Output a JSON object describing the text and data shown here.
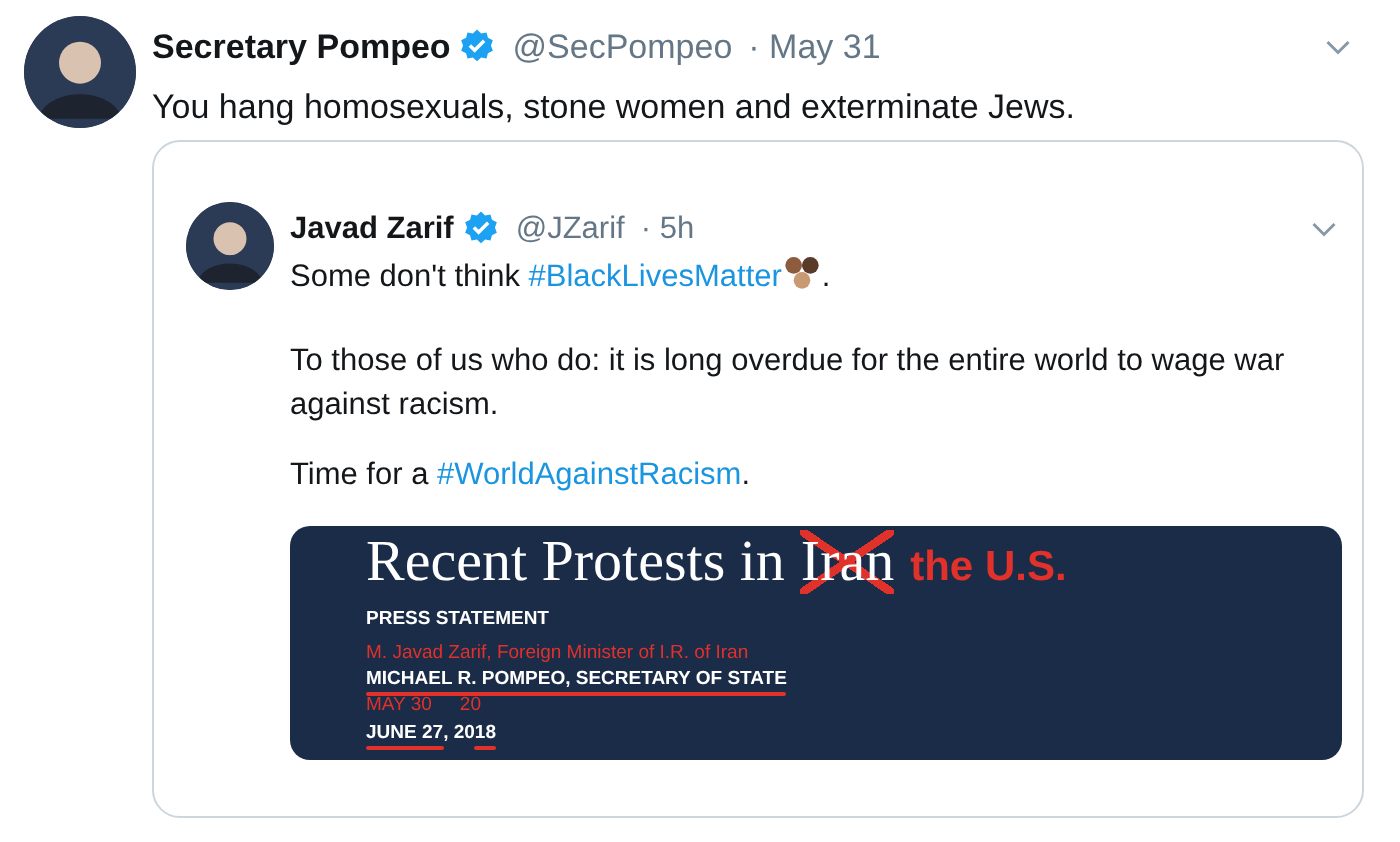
{
  "tweet": {
    "author": {
      "name": "Secretary Pompeo",
      "verified": true,
      "handle": "@SecPompeo",
      "time": "· May 31"
    },
    "text": [
      {
        "kind": "text",
        "text": "You hang homosexuals, stone women and exterminate Jews."
      }
    ],
    "quoted": {
      "author": {
        "name": "Javad Zarif",
        "verified": true,
        "handle": "@JZarif",
        "time": "· 5h"
      },
      "paragraphs": [
        [
          {
            "kind": "text",
            "text": "Some don't think "
          },
          {
            "kind": "hashtag",
            "text": "#BlackLivesMatter"
          },
          {
            "kind": "emoji"
          },
          {
            "kind": "text",
            "text": "."
          }
        ],
        [
          {
            "kind": "text",
            "text": "To those of us who do: it is long overdue for the entire world to wage war against racism."
          }
        ],
        [
          {
            "kind": "text",
            "text": "Time for a "
          },
          {
            "kind": "hashtag",
            "text": "#WorldAgainstRacism"
          },
          {
            "kind": "text",
            "text": "."
          }
        ]
      ],
      "image": {
        "title": [
          {
            "kind": "plain",
            "text": "Recent Protests in"
          },
          {
            "kind": "crossed",
            "text": "Iran"
          },
          {
            "kind": "inserted",
            "text": "the U.S."
          }
        ],
        "lines": [
          [
            {
              "kind": "heading",
              "text": "PRESS STATEMENT"
            }
          ],
          [
            {
              "kind": "inserted",
              "text": "M. Javad Zarif, Foreign Minister of I.R. of Iran"
            }
          ],
          [
            {
              "kind": "struck",
              "text": "MICHAEL R. POMPEO, SECRETARY OF STATE"
            }
          ],
          [
            {
              "kind": "inserted",
              "text": "MAY 30"
            },
            {
              "kind": "inserted",
              "text": "20"
            }
          ],
          [
            {
              "kind": "struck",
              "text": "JUNE 27"
            },
            {
              "kind": "plain",
              "text": ", 20"
            },
            {
              "kind": "struck",
              "text": "18"
            }
          ]
        ]
      }
    }
  }
}
